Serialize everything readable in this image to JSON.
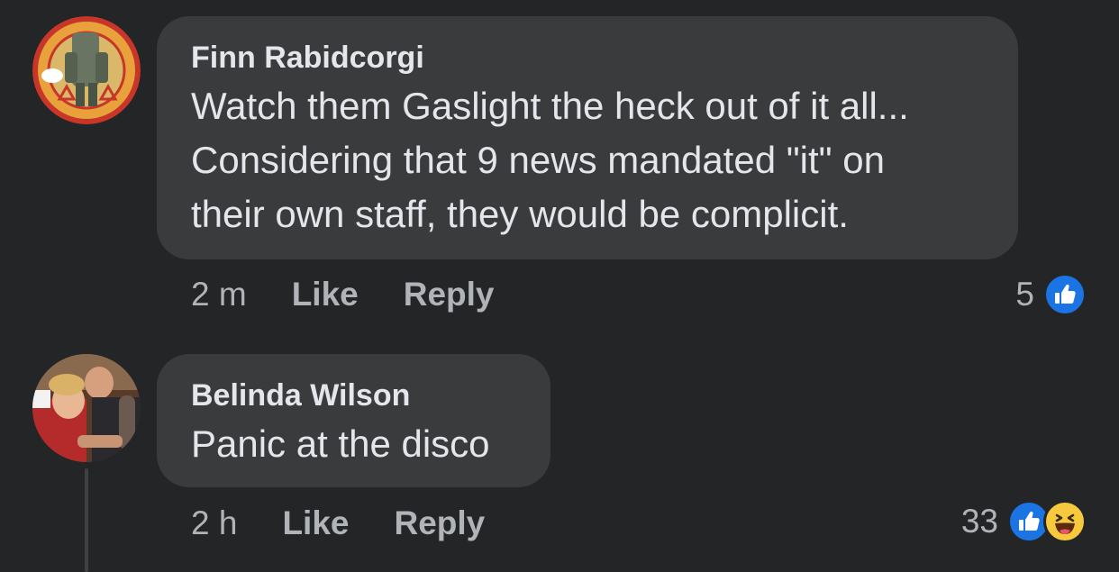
{
  "comments": [
    {
      "author": "Finn Rabidcorgi",
      "lines": [
        "Watch them Gaslight the heck out of it all...",
        "Considering that 9 news mandated \"it\" on",
        "their own staff, they would be complicit."
      ],
      "time": "2 m",
      "like_label": "Like",
      "reply_label": "Reply",
      "reaction_count": "5",
      "reactions": [
        "like-icon"
      ]
    },
    {
      "author": "Belinda Wilson",
      "lines": [
        "Panic at the disco"
      ],
      "time": "2 h",
      "like_label": "Like",
      "reply_label": "Reply",
      "reaction_count": "33",
      "reactions": [
        "like-icon",
        "haha-icon"
      ]
    }
  ],
  "colors": {
    "background": "#242526",
    "bubble": "#3a3b3c",
    "like_blue": "#1b74e4",
    "haha_yellow": "#f7c93c"
  }
}
